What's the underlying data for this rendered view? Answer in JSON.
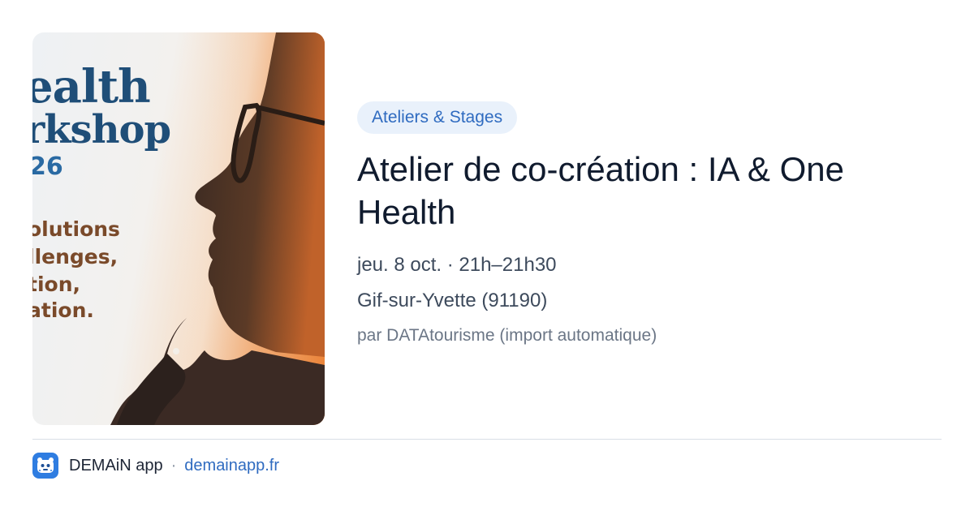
{
  "event_image": {
    "poster_lines": [
      "ealth",
      "rkshop",
      "26",
      "olutions",
      "llenges,",
      "tion,",
      "ation."
    ]
  },
  "event": {
    "category": "Ateliers & Stages",
    "title": "Atelier de co-création : IA & One Health",
    "date_time": "jeu. 8 oct. · 21h–21h30",
    "location": "Gif-sur-Yvette (91190)",
    "source": "par DATAtourisme (import automatique)"
  },
  "footer": {
    "app_name": "DEMAiN app",
    "separator": "·",
    "domain": "demainapp.fr",
    "logo_icon": "demain-app-logo-icon"
  },
  "colors": {
    "accent": "#2f6bc0",
    "badge_bg": "#e9f1fb",
    "title": "#101b2e",
    "muted": "#6b7686"
  }
}
